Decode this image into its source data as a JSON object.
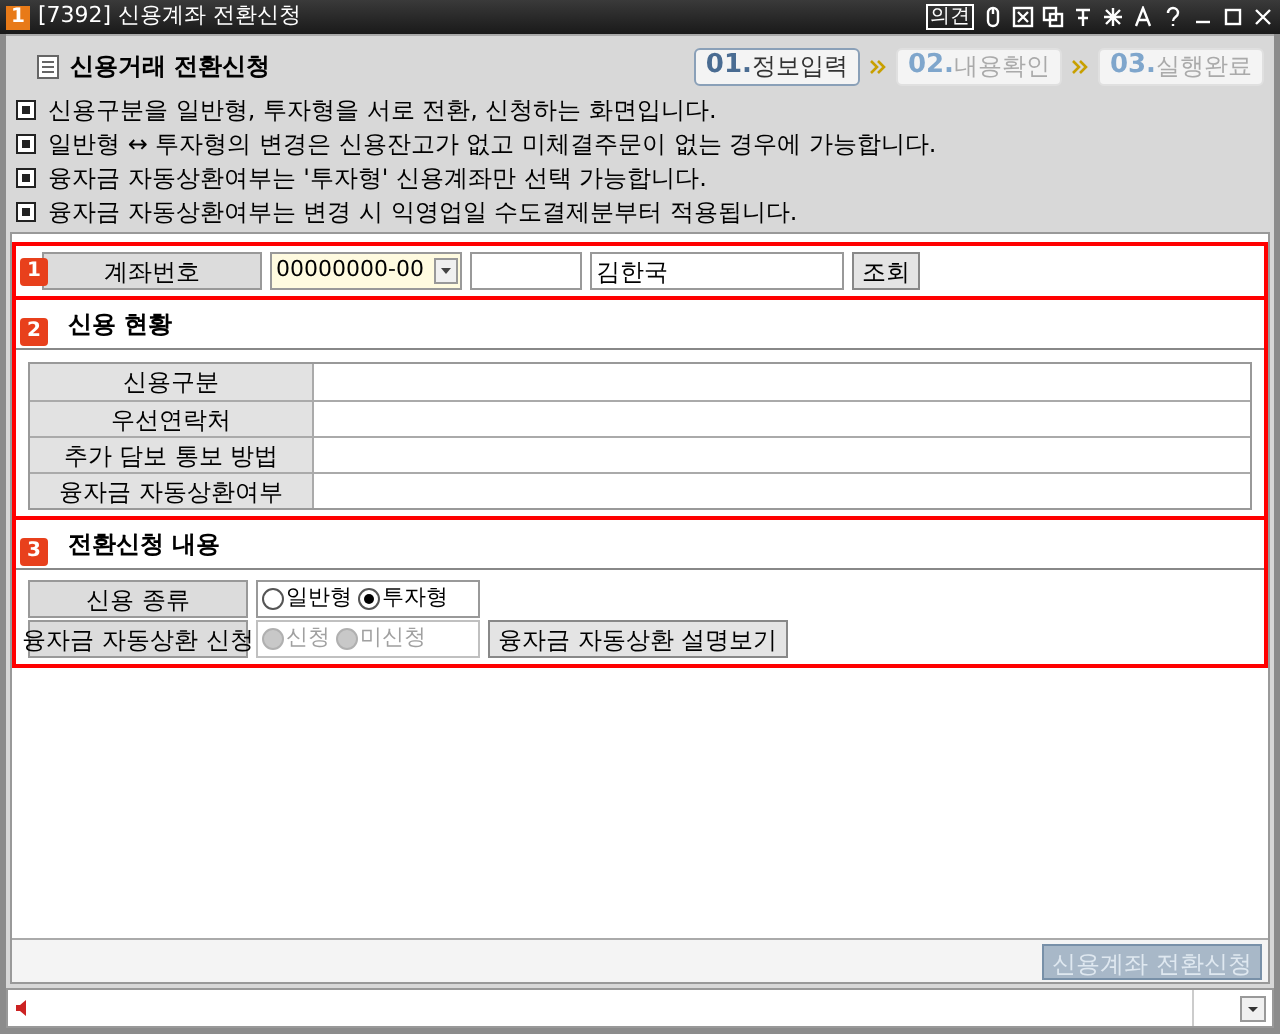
{
  "window": {
    "number": "1",
    "title": "[7392] 신용계좌 전환신청",
    "opinion_button": "의견"
  },
  "header": {
    "title": "신용거래 전환신청"
  },
  "steps": [
    {
      "number": "01.",
      "label": "정보입력",
      "selected": true
    },
    {
      "number": "02.",
      "label": "내용확인",
      "selected": false
    },
    {
      "number": "03.",
      "label": "실행완료",
      "selected": false
    }
  ],
  "notes": [
    "신용구분을 일반형, 투자형을 서로 전환, 신청하는 화면입니다.",
    "일반형 ↔ 투자형의 변경은 신용잔고가 없고 미체결주문이 없는 경우에 가능합니다.",
    "융자금 자동상환여부는 '투자형' 신용계좌만 선택 가능합니다.",
    "융자금 자동상환여부는 변경 시 익영업일 수도결제분부터 적용됩니다."
  ],
  "account": {
    "badge": "1",
    "label": "계좌번호",
    "account_number": "00000000-00",
    "name": "김한국",
    "query_button": "조회"
  },
  "credit_status": {
    "badge": "2",
    "title": "신용 현황",
    "rows": [
      {
        "label": "신용구분"
      },
      {
        "label": "우선연락처"
      },
      {
        "label": "추가 담보 통보 방법"
      },
      {
        "label": "융자금 자동상환여부"
      }
    ]
  },
  "application": {
    "badge": "3",
    "title": "전환신청 내용",
    "credit_type": {
      "label": "신용 종류",
      "disabled": false,
      "options": [
        {
          "label": "일반형",
          "selected": false
        },
        {
          "label": "투자형",
          "selected": true
        }
      ]
    },
    "auto_repay": {
      "label": "융자금 자동상환 신청",
      "disabled": true,
      "options": [
        {
          "label": "신청",
          "selected": false
        },
        {
          "label": "미신청",
          "selected": false
        }
      ],
      "help_button": "융자금 자동상환 설명보기"
    }
  },
  "submit_button": {
    "label": "신용계좌 전환신청",
    "disabled": true
  }
}
